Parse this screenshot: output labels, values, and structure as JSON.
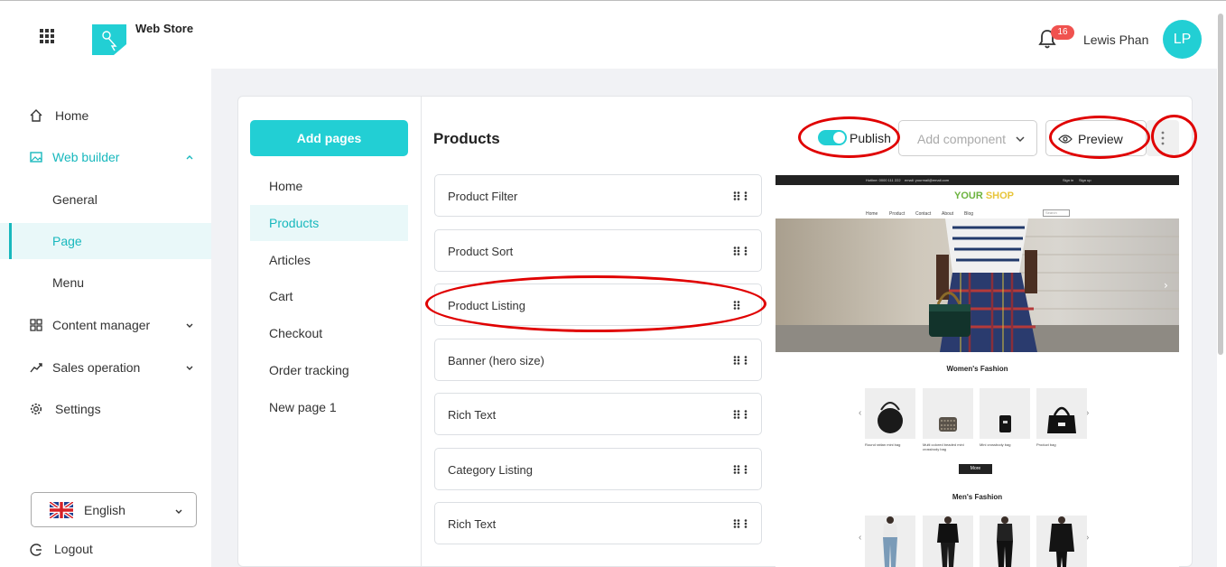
{
  "header": {
    "app_name": "Web Store",
    "notification_count": "16",
    "user_name": "Lewis Phan",
    "avatar_initials": "LP"
  },
  "sidebar": {
    "items": [
      {
        "label": "Home",
        "icon": "home-icon"
      },
      {
        "label": "Web builder",
        "icon": "image-icon"
      },
      {
        "label": "General"
      },
      {
        "label": "Page"
      },
      {
        "label": "Menu"
      },
      {
        "label": "Content manager",
        "icon": "grid-icon"
      },
      {
        "label": "Sales operation",
        "icon": "trend-icon"
      },
      {
        "label": "Settings",
        "icon": "gear-icon"
      }
    ],
    "language": "English",
    "logout": "Logout"
  },
  "pages_panel": {
    "add_button": "Add pages",
    "pages": [
      "Home",
      "Products",
      "Articles",
      "Cart",
      "Checkout",
      "Order tracking",
      "New page 1"
    ]
  },
  "editor": {
    "title": "Products",
    "publish_label": "Publish",
    "add_component_placeholder": "Add component",
    "preview_label": "Preview",
    "components": [
      "Product Filter",
      "Product Sort",
      "Product Listing",
      "Banner (hero size)",
      "Rich Text",
      "Category Listing",
      "Rich Text"
    ]
  },
  "preview": {
    "topbar_left": "Hotline: 0000 111 222",
    "topbar_email": "email: yourmail@email.com",
    "topbar_signin": "Sign in",
    "topbar_signup": "Sign up",
    "shop_name_1": "YOUR",
    "shop_name_2": "SHOP",
    "nav": [
      "Home",
      "Product",
      "Contact",
      "About",
      "Blog"
    ],
    "search_placeholder": "Search",
    "section1": "Women's Fashion",
    "products": [
      {
        "name": "Round rattan mini bag"
      },
      {
        "name": "Multi colored beaded mini crossbody bag"
      },
      {
        "name": "Mini crossbody bag"
      },
      {
        "name": "Product bag"
      }
    ],
    "more_button": "More",
    "section2": "Men's Fashion"
  },
  "colors": {
    "accent": "#22cfd4",
    "badge": "#f0524f",
    "highlight_ring": "#e00000"
  }
}
